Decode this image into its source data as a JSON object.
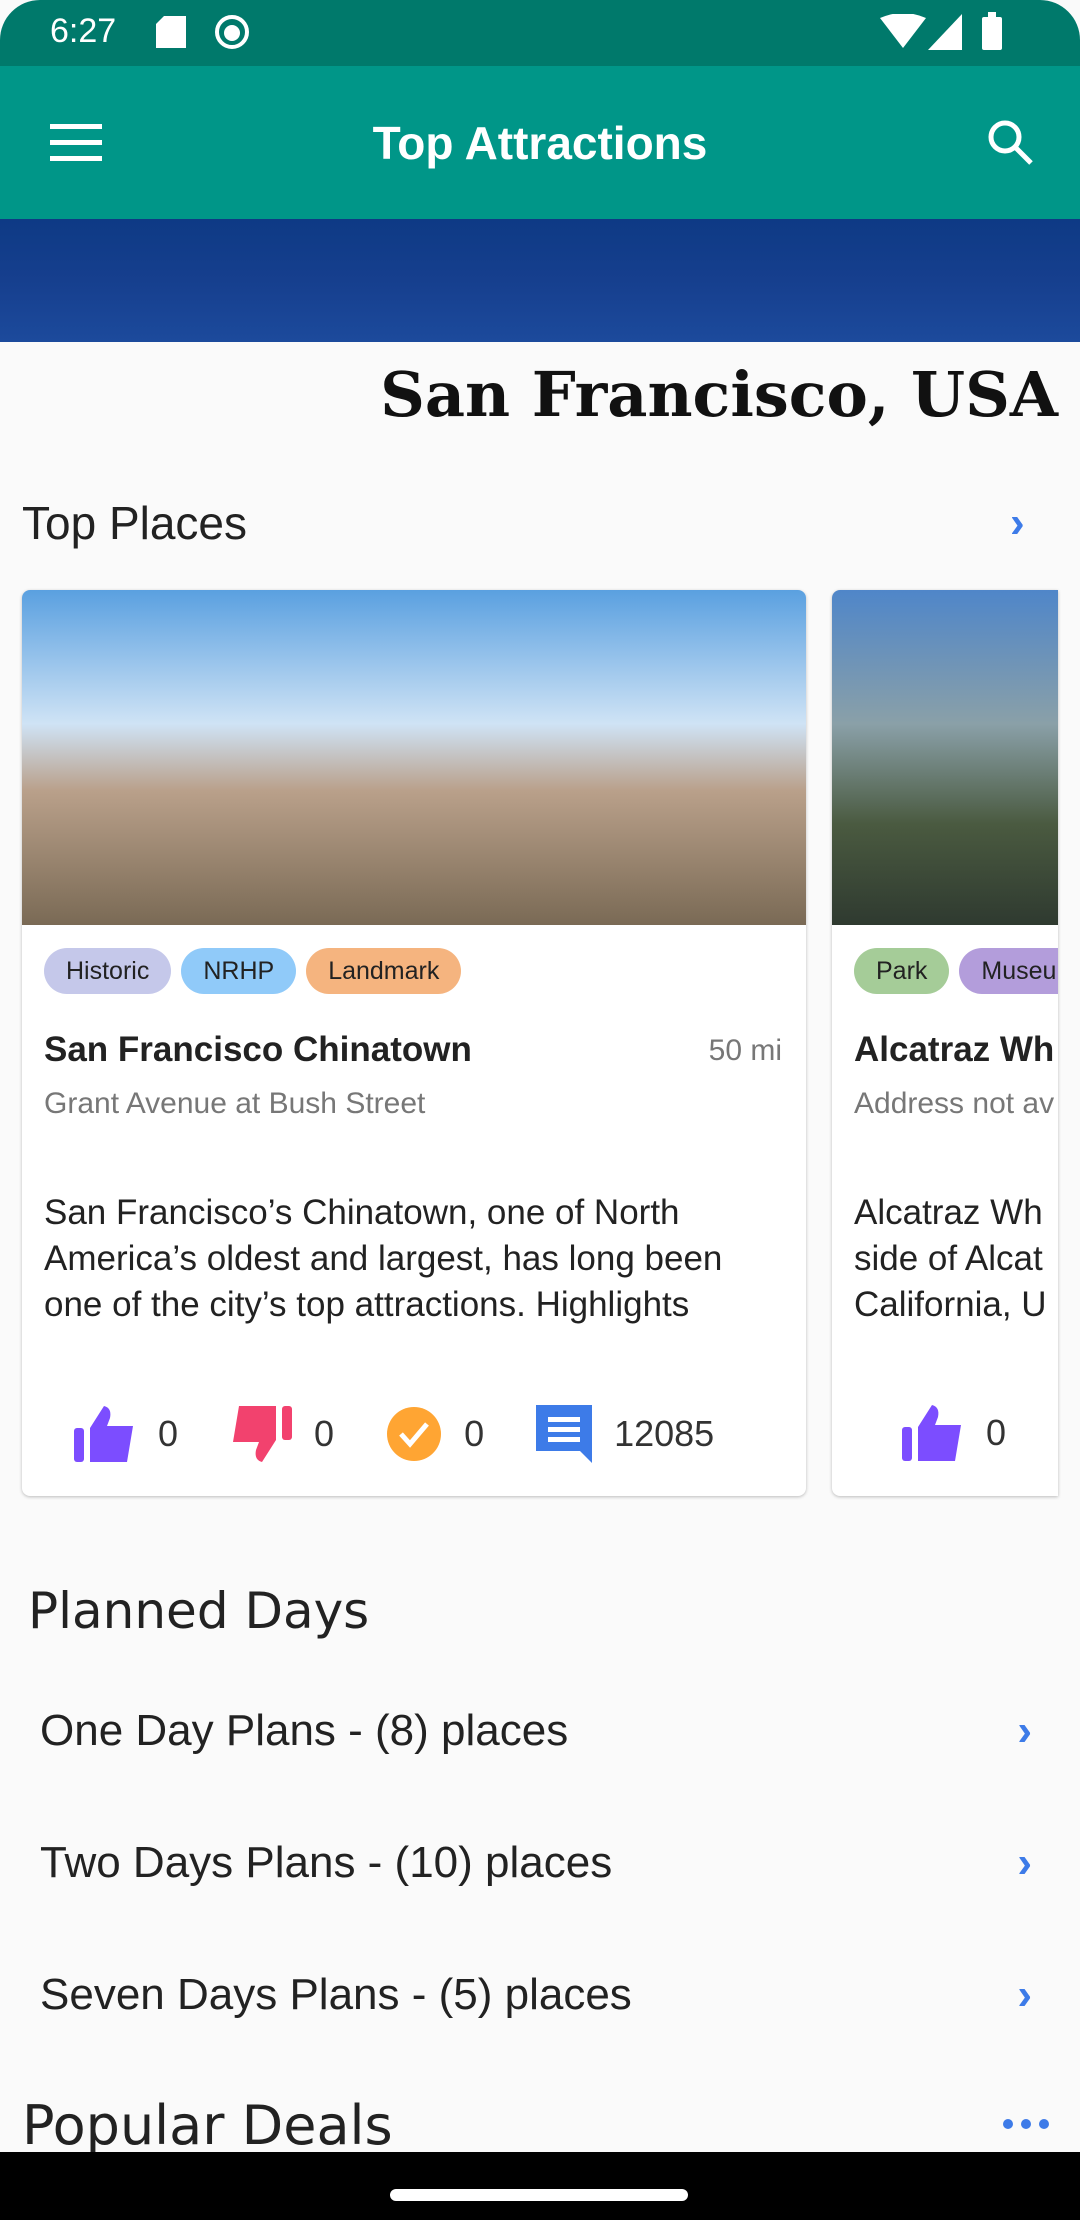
{
  "status_bar": {
    "time": "6:27"
  },
  "app_bar": {
    "title": "Top Attractions"
  },
  "city": "San Francisco, USA",
  "top_places": {
    "title": "Top Places",
    "cards": [
      {
        "tags": [
          {
            "label": "Historic",
            "color": "#c5c8ea"
          },
          {
            "label": "NRHP",
            "color": "#90caf9"
          },
          {
            "label": "Landmark",
            "color": "#f5b47f"
          }
        ],
        "name": "San Francisco Chinatown",
        "distance": "50 mi",
        "address": "Grant Avenue at Bush Street",
        "description": "San Francisco’s Chinatown, one of North America’s oldest and largest, has long been one of the city’s top attractions. Highlights",
        "likes": "0",
        "dislikes": "0",
        "visited": "0",
        "comments": "12085"
      },
      {
        "tags": [
          {
            "label": "Park",
            "color": "#a5cc98"
          },
          {
            "label": "Museum",
            "color": "#b39ddb"
          }
        ],
        "name": "Alcatraz Wh",
        "address": "Address not av",
        "description": "Alcatraz Wh side of Alcat California, U",
        "likes": "0"
      }
    ]
  },
  "planned_days": {
    "title": "Planned Days",
    "items": [
      {
        "label": "One Day Plans - (8) places"
      },
      {
        "label": "Two Days Plans - (10) places"
      },
      {
        "label": "Seven Days Plans - (5) places"
      }
    ]
  },
  "popular_deals": {
    "title": "Popular Deals"
  },
  "colors": {
    "status": "#00796b",
    "appbar": "#009688",
    "accent": "#3d7be8",
    "like": "#7c4dff",
    "dislike": "#f2426e",
    "visited": "#ffa533",
    "comment": "#3d7be8"
  }
}
